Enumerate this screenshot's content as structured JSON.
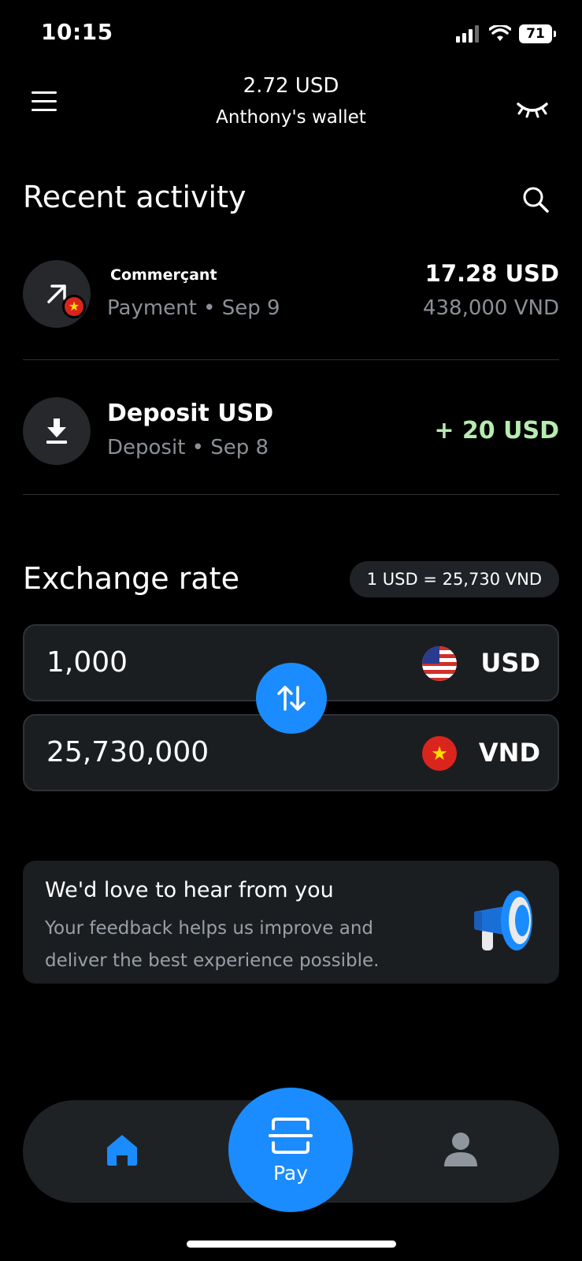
{
  "status_bar": {
    "time": "10:15",
    "battery": "71"
  },
  "header": {
    "balance": "2.72 USD",
    "wallet_name": "Anthony's wallet"
  },
  "recent_activity": {
    "title": "Recent activity",
    "items": [
      {
        "name": "Commerçant",
        "subtitle": "Payment • Sep 9",
        "amount": "17.28 USD",
        "amount_secondary": "438,000 VND",
        "icon": "arrow-up-right-icon"
      },
      {
        "name": "Deposit USD",
        "subtitle": "Deposit • Sep 8",
        "amount": "+ 20 USD",
        "icon": "download-icon"
      }
    ]
  },
  "exchange": {
    "title": "Exchange rate",
    "rate": "1 USD = 25,730 VND",
    "from": {
      "value": "1,000",
      "currency": "USD"
    },
    "to": {
      "value": "25,730,000",
      "currency": "VND"
    }
  },
  "feedback": {
    "title": "We'd love to hear from you",
    "text": "Your feedback helps us improve and deliver the best experience possible."
  },
  "nav": {
    "pay_label": "Pay"
  },
  "colors": {
    "accent": "#1a8cff",
    "positive": "#b7ebb0",
    "background": "#000000",
    "card": "#1b1e21"
  }
}
